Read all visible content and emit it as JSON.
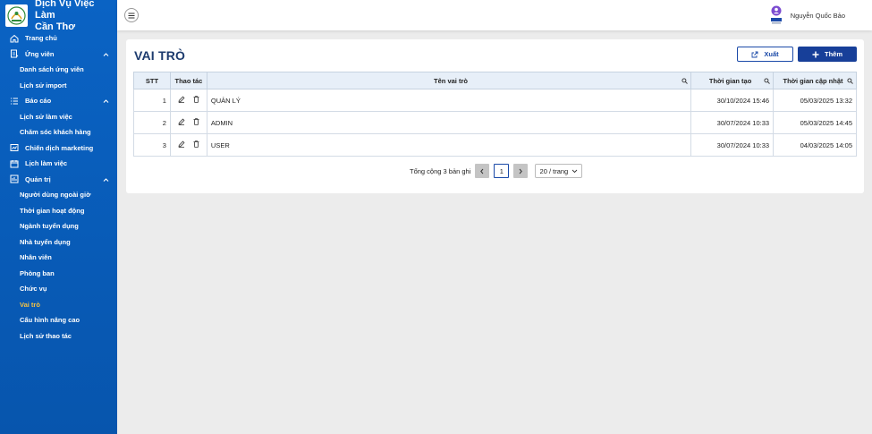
{
  "brand": {
    "name": "Dịch Vụ Việc Làm\nCần Thơ"
  },
  "sidebar": {
    "items": [
      {
        "label": "Trang chủ",
        "icon": "home-icon"
      },
      {
        "label": "Ứng viên",
        "icon": "document-icon",
        "expanded": true
      },
      {
        "label": "Danh sách ứng viên"
      },
      {
        "label": "Lịch sử import"
      },
      {
        "label": "Báo cáo",
        "icon": "list-icon",
        "expanded": true
      },
      {
        "label": "Lịch sử làm việc"
      },
      {
        "label": "Chăm sóc khách hàng"
      },
      {
        "label": "Chiến dịch marketing",
        "icon": "campaign-icon"
      },
      {
        "label": "Lịch làm việc",
        "icon": "calendar-icon"
      },
      {
        "label": "Quản trị",
        "icon": "admin-icon",
        "expanded": true
      },
      {
        "label": "Người dùng ngoài giờ"
      },
      {
        "label": "Thời gian hoạt động"
      },
      {
        "label": "Ngành tuyển dụng"
      },
      {
        "label": "Nhà tuyển dụng"
      },
      {
        "label": "Nhân viên"
      },
      {
        "label": "Phòng ban"
      },
      {
        "label": "Chức vụ"
      },
      {
        "label": "Vai trò",
        "active": true
      },
      {
        "label": "Cấu hình nâng cao"
      },
      {
        "label": "Lịch sử thao tác"
      }
    ]
  },
  "header": {
    "user_name": "Nguyễn Quốc Bảo"
  },
  "main": {
    "title": "VAI TRÒ",
    "export_label": "Xuất",
    "add_label": "Thêm",
    "columns": {
      "stt": "STT",
      "actions": "Thao tác",
      "name": "Tên vai trò",
      "created": "Thời gian tạo",
      "updated": "Thời gian cập nhật"
    },
    "rows": [
      {
        "stt": "1",
        "name": "QUẢN LÝ",
        "created": "30/10/2024 15:46",
        "updated": "05/03/2025 13:32"
      },
      {
        "stt": "2",
        "name": "ADMIN",
        "created": "30/07/2024 10:33",
        "updated": "05/03/2025 14:45"
      },
      {
        "stt": "3",
        "name": "USER",
        "created": "30/07/2024 10:33",
        "updated": "04/03/2025 14:05"
      }
    ],
    "pagination": {
      "total_text": "Tổng cộng 3 bản ghi",
      "current_page": "1",
      "page_size": "20 / trang"
    }
  },
  "colors": {
    "sidebar_bg": "#0a63c4",
    "active_item": "#f5c242",
    "primary": "#173f99",
    "title": "#1d3b6e"
  }
}
